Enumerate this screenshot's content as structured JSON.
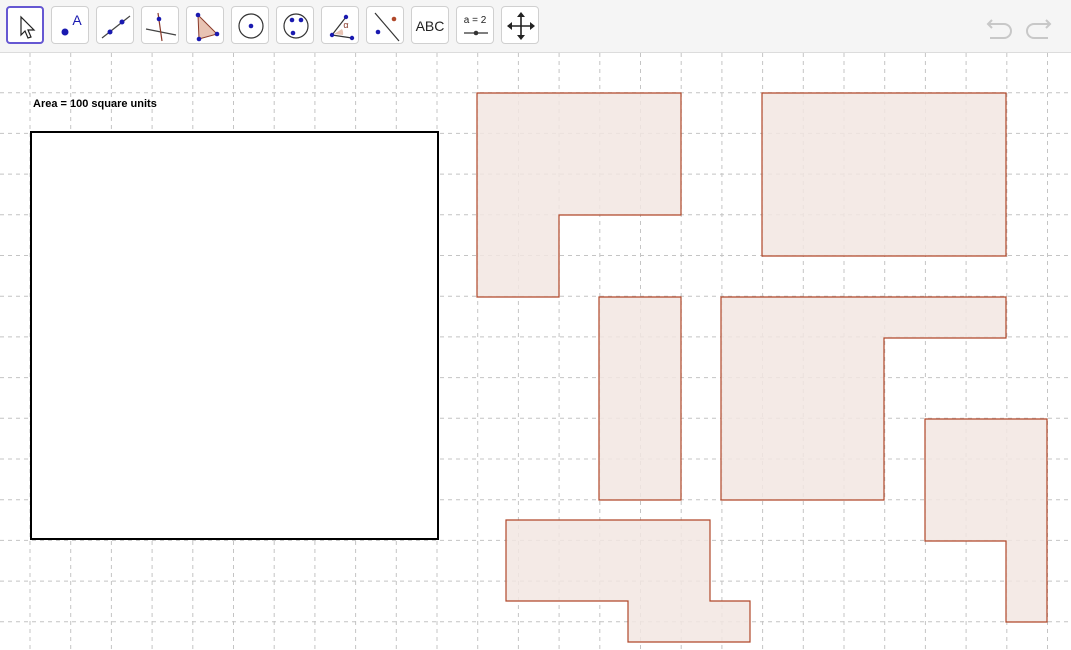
{
  "toolbar": {
    "tools": [
      {
        "name": "move-tool",
        "icon": "arrow-cursor-icon",
        "selected": true
      },
      {
        "name": "point-tool",
        "icon": "point-icon",
        "label": "A"
      },
      {
        "name": "line-tool",
        "icon": "line-through-points-icon"
      },
      {
        "name": "perpendicular-line-tool",
        "icon": "perpendicular-line-icon"
      },
      {
        "name": "polygon-tool",
        "icon": "polygon-icon"
      },
      {
        "name": "circle-tool",
        "icon": "circle-center-point-icon"
      },
      {
        "name": "circle-three-points-tool",
        "icon": "circle-three-points-icon"
      },
      {
        "name": "angle-tool",
        "icon": "angle-icon",
        "label": "α"
      },
      {
        "name": "reflect-tool",
        "icon": "reflect-about-line-icon"
      },
      {
        "name": "text-tool",
        "icon": "text-icon",
        "label": "ABC"
      },
      {
        "name": "slider-tool",
        "icon": "slider-icon",
        "label": "a = 2"
      },
      {
        "name": "move-graphics-view-tool",
        "icon": "move-view-icon"
      }
    ],
    "undo_icon": "undo-icon",
    "redo_icon": "redo-icon"
  },
  "canvas": {
    "area_label": "Area = 100 square units",
    "grid": true,
    "grid_style": "dashed",
    "shape_fill": "#f2e6e2",
    "shape_stroke": "#b0482a",
    "square_stroke": "#000000"
  }
}
